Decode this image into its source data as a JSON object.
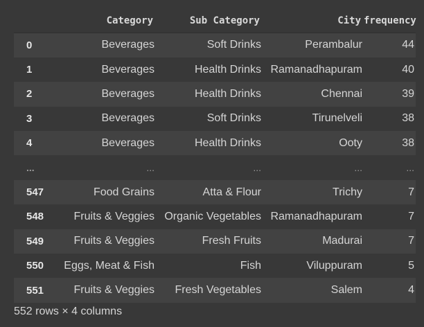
{
  "table": {
    "columns": [
      "",
      "Category",
      "Sub Category",
      "City",
      "frequency"
    ],
    "rows": [
      {
        "index": "0",
        "category": "Beverages",
        "sub_category": "Soft Drinks",
        "city": "Perambalur",
        "frequency": "44"
      },
      {
        "index": "1",
        "category": "Beverages",
        "sub_category": "Health Drinks",
        "city": "Ramanadhapuram",
        "frequency": "40"
      },
      {
        "index": "2",
        "category": "Beverages",
        "sub_category": "Health Drinks",
        "city": "Chennai",
        "frequency": "39"
      },
      {
        "index": "3",
        "category": "Beverages",
        "sub_category": "Soft Drinks",
        "city": "Tirunelveli",
        "frequency": "38"
      },
      {
        "index": "4",
        "category": "Beverages",
        "sub_category": "Health Drinks",
        "city": "Ooty",
        "frequency": "38"
      },
      {
        "index": "...",
        "category": "...",
        "sub_category": "...",
        "city": "...",
        "frequency": "..."
      },
      {
        "index": "547",
        "category": "Food Grains",
        "sub_category": "Atta & Flour",
        "city": "Trichy",
        "frequency": "7"
      },
      {
        "index": "548",
        "category": "Fruits & Veggies",
        "sub_category": "Organic Vegetables",
        "city": "Ramanadhapuram",
        "frequency": "7"
      },
      {
        "index": "549",
        "category": "Fruits & Veggies",
        "sub_category": "Fresh Fruits",
        "city": "Madurai",
        "frequency": "7"
      },
      {
        "index": "550",
        "category": "Eggs, Meat & Fish",
        "sub_category": "Fish",
        "city": "Viluppuram",
        "frequency": "5"
      },
      {
        "index": "551",
        "category": "Fruits & Veggies",
        "sub_category": "Fresh Vegetables",
        "city": "Salem",
        "frequency": "4"
      }
    ]
  },
  "shape_text": "552 rows × 4 columns",
  "colors": {
    "background": "#383838",
    "row_stripe": "#424242",
    "text": "#d5d5d5"
  }
}
